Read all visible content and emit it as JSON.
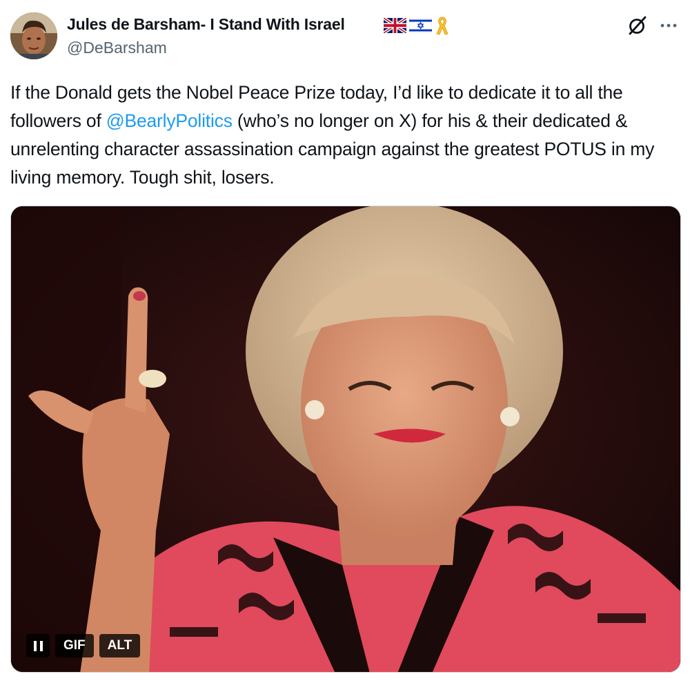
{
  "author": {
    "display_name": "Jules de Barsham- I Stand With Israel",
    "handle": "@DeBarsham",
    "badges": [
      "uk-flag-icon",
      "israel-flag-icon",
      "yellow-ribbon-icon"
    ]
  },
  "actions": {
    "grok_icon": "grok-icon",
    "more_icon": "more-icon"
  },
  "tweet": {
    "text_before_mention": "If the Donald gets the Nobel Peace Prize today, I’d like to dedicate it to all the followers of ",
    "mention": "@BearlyPolitics",
    "text_after_mention": " (who’s no longer on X) for his & their dedicated & unrelenting character assassination campaign against the greatest POTUS in my living memory. Tough shit, losers."
  },
  "media": {
    "type": "gif",
    "gif_label": "GIF",
    "alt_label": "ALT",
    "pause_icon": "pause-icon"
  },
  "colors": {
    "text": "#0f1419",
    "secondary_text": "#536471",
    "link": "#1d9bf0",
    "media_border": "#cfd9de"
  }
}
